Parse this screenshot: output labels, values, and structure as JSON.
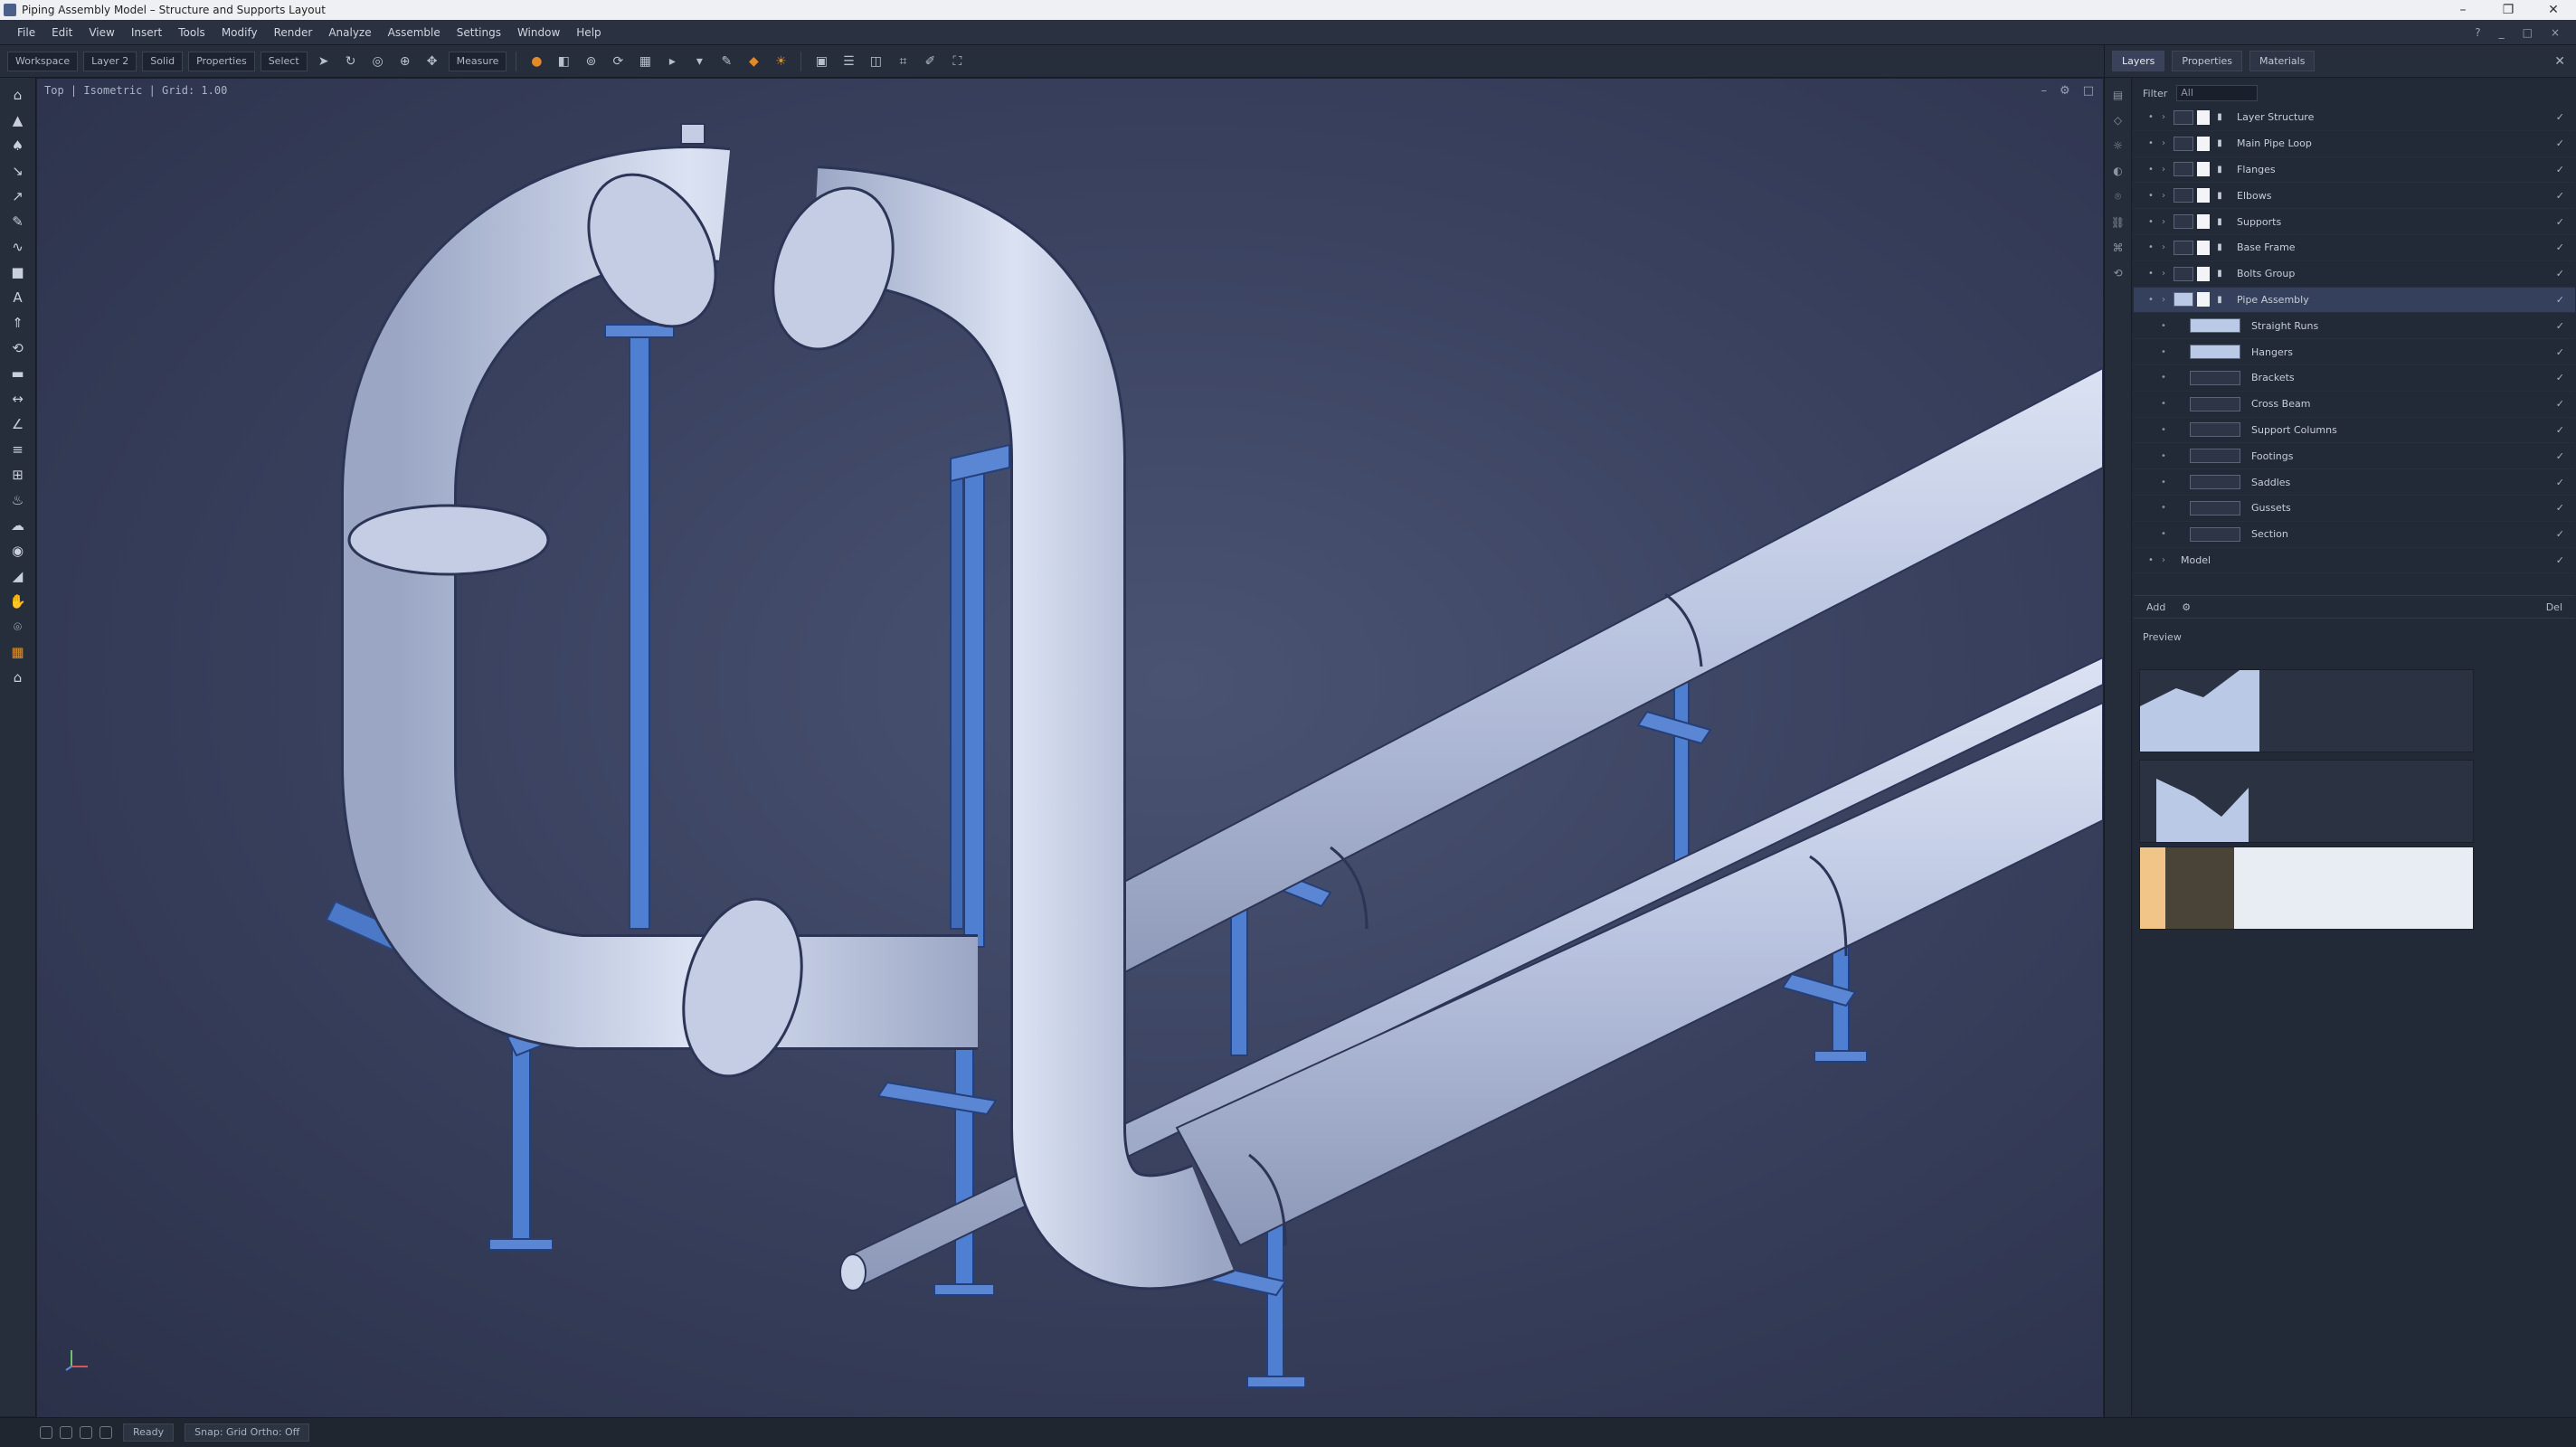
{
  "window": {
    "title": "Piping Assembly Model – Structure and Supports Layout"
  },
  "menu": [
    "File",
    "Edit",
    "View",
    "Insert",
    "Tools",
    "Modify",
    "Render",
    "Analyze",
    "Assemble",
    "Settings",
    "Window",
    "Help"
  ],
  "toolbar": {
    "workspace": "Workspace",
    "field1": "Layer 2",
    "field2": "Solid",
    "field3": "Properties",
    "field4": "Select",
    "field5": "Measure"
  },
  "viewport": {
    "label": "Top | Isometric | Grid: 1.00"
  },
  "panel": {
    "tabs": [
      "Layers",
      "Properties",
      "Materials"
    ],
    "filter_label": "Filter",
    "filter_placeholder": "All",
    "layers": [
      {
        "name": "Layer Structure",
        "thumb": "dark",
        "selected": false,
        "child": false
      },
      {
        "name": "Main Pipe Loop",
        "thumb": "dark",
        "selected": false,
        "child": false
      },
      {
        "name": "Flanges",
        "thumb": "dark",
        "selected": false,
        "child": false
      },
      {
        "name": "Elbows",
        "thumb": "dark",
        "selected": false,
        "child": false
      },
      {
        "name": "Supports",
        "thumb": "dark",
        "selected": false,
        "child": false
      },
      {
        "name": "Base Frame",
        "thumb": "dark",
        "selected": false,
        "child": false
      },
      {
        "name": "Bolts Group",
        "thumb": "dark",
        "selected": false,
        "child": false
      },
      {
        "name": "Pipe Assembly",
        "thumb": "light",
        "selected": true,
        "child": false
      },
      {
        "name": "Straight Runs",
        "thumb": "light",
        "selected": false,
        "child": true
      },
      {
        "name": "Hangers",
        "thumb": "light",
        "selected": false,
        "child": true
      },
      {
        "name": "Brackets",
        "thumb": "dark",
        "selected": false,
        "child": true
      },
      {
        "name": "Cross Beam",
        "thumb": "dark",
        "selected": false,
        "child": true
      },
      {
        "name": "Support Columns",
        "thumb": "dark",
        "selected": false,
        "child": true
      },
      {
        "name": "Footings",
        "thumb": "dark",
        "selected": false,
        "child": true
      },
      {
        "name": "Saddles",
        "thumb": "dark",
        "selected": false,
        "child": true
      },
      {
        "name": "Gussets",
        "thumb": "dark",
        "selected": false,
        "child": true
      },
      {
        "name": "Section",
        "thumb": "dark",
        "selected": false,
        "child": true
      },
      {
        "name": "Model",
        "thumb": "none",
        "selected": false,
        "child": false
      }
    ],
    "footer_left": "Add",
    "footer_right": "Del",
    "props_title": "Preview"
  },
  "status": {
    "field1": "Ready",
    "field2": "Snap: Grid  Ortho: Off"
  },
  "colors": {
    "pipe": "#b9c4e0",
    "steel": "#4f7fd0",
    "accent": "#e2932e"
  }
}
